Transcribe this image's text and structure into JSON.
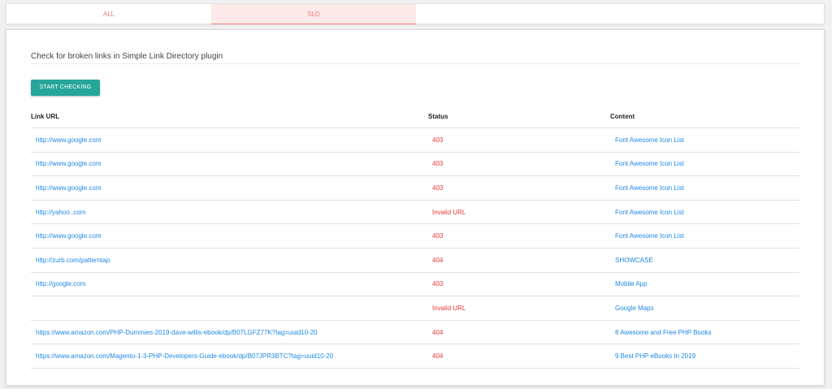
{
  "tabs": [
    {
      "label": "ALL",
      "active": false
    },
    {
      "label": "SLD",
      "active": true
    }
  ],
  "panel": {
    "title": "Check for broken links in Simple Link Directory plugin",
    "start_button": "START CHECKING"
  },
  "table": {
    "headers": [
      "Link URL",
      "Status",
      "Content"
    ],
    "rows": [
      {
        "url": "http://www.google.com",
        "status": "403",
        "content": "Font Awesome Icon List"
      },
      {
        "url": "http://www.google.com",
        "status": "403",
        "content": "Font Awesome Icon List"
      },
      {
        "url": "http://www.google.com",
        "status": "403",
        "content": "Font Awesome Icon List"
      },
      {
        "url": "http://yahoo..com",
        "status": "Invalid URL",
        "content": "Font Awesome Icon List"
      },
      {
        "url": "http://www.google.com",
        "status": "403",
        "content": "Font Awesome Icon List"
      },
      {
        "url": "http://zurb.com/patterntap",
        "status": "404",
        "content": "SHOWCASE"
      },
      {
        "url": "http://google.com",
        "status": "403",
        "content": "Mobile App"
      },
      {
        "url": "",
        "status": "Invalid URL",
        "content": "Google Maps"
      },
      {
        "url": "https://www.amazon.com/PHP-Dummies-2019-dave-willis-ebook/dp/B07LGFZ77K?tag=uuid10-20",
        "status": "404",
        "content": "8 Awesome and Free PHP Books"
      },
      {
        "url": "https://www.amazon.com/Magento-1-3-PHP-Developers-Guide-ebook/dp/B07JPR3BTC?tag=uuid10-20",
        "status": "404",
        "content": "9 Best PHP eBooks In 2019"
      }
    ]
  },
  "colors": {
    "accent": "#26a69a",
    "link": "#1e88e5",
    "error": "#e53935",
    "tab_text": "#f08080",
    "tab_active_bg": "#fde9e9"
  }
}
